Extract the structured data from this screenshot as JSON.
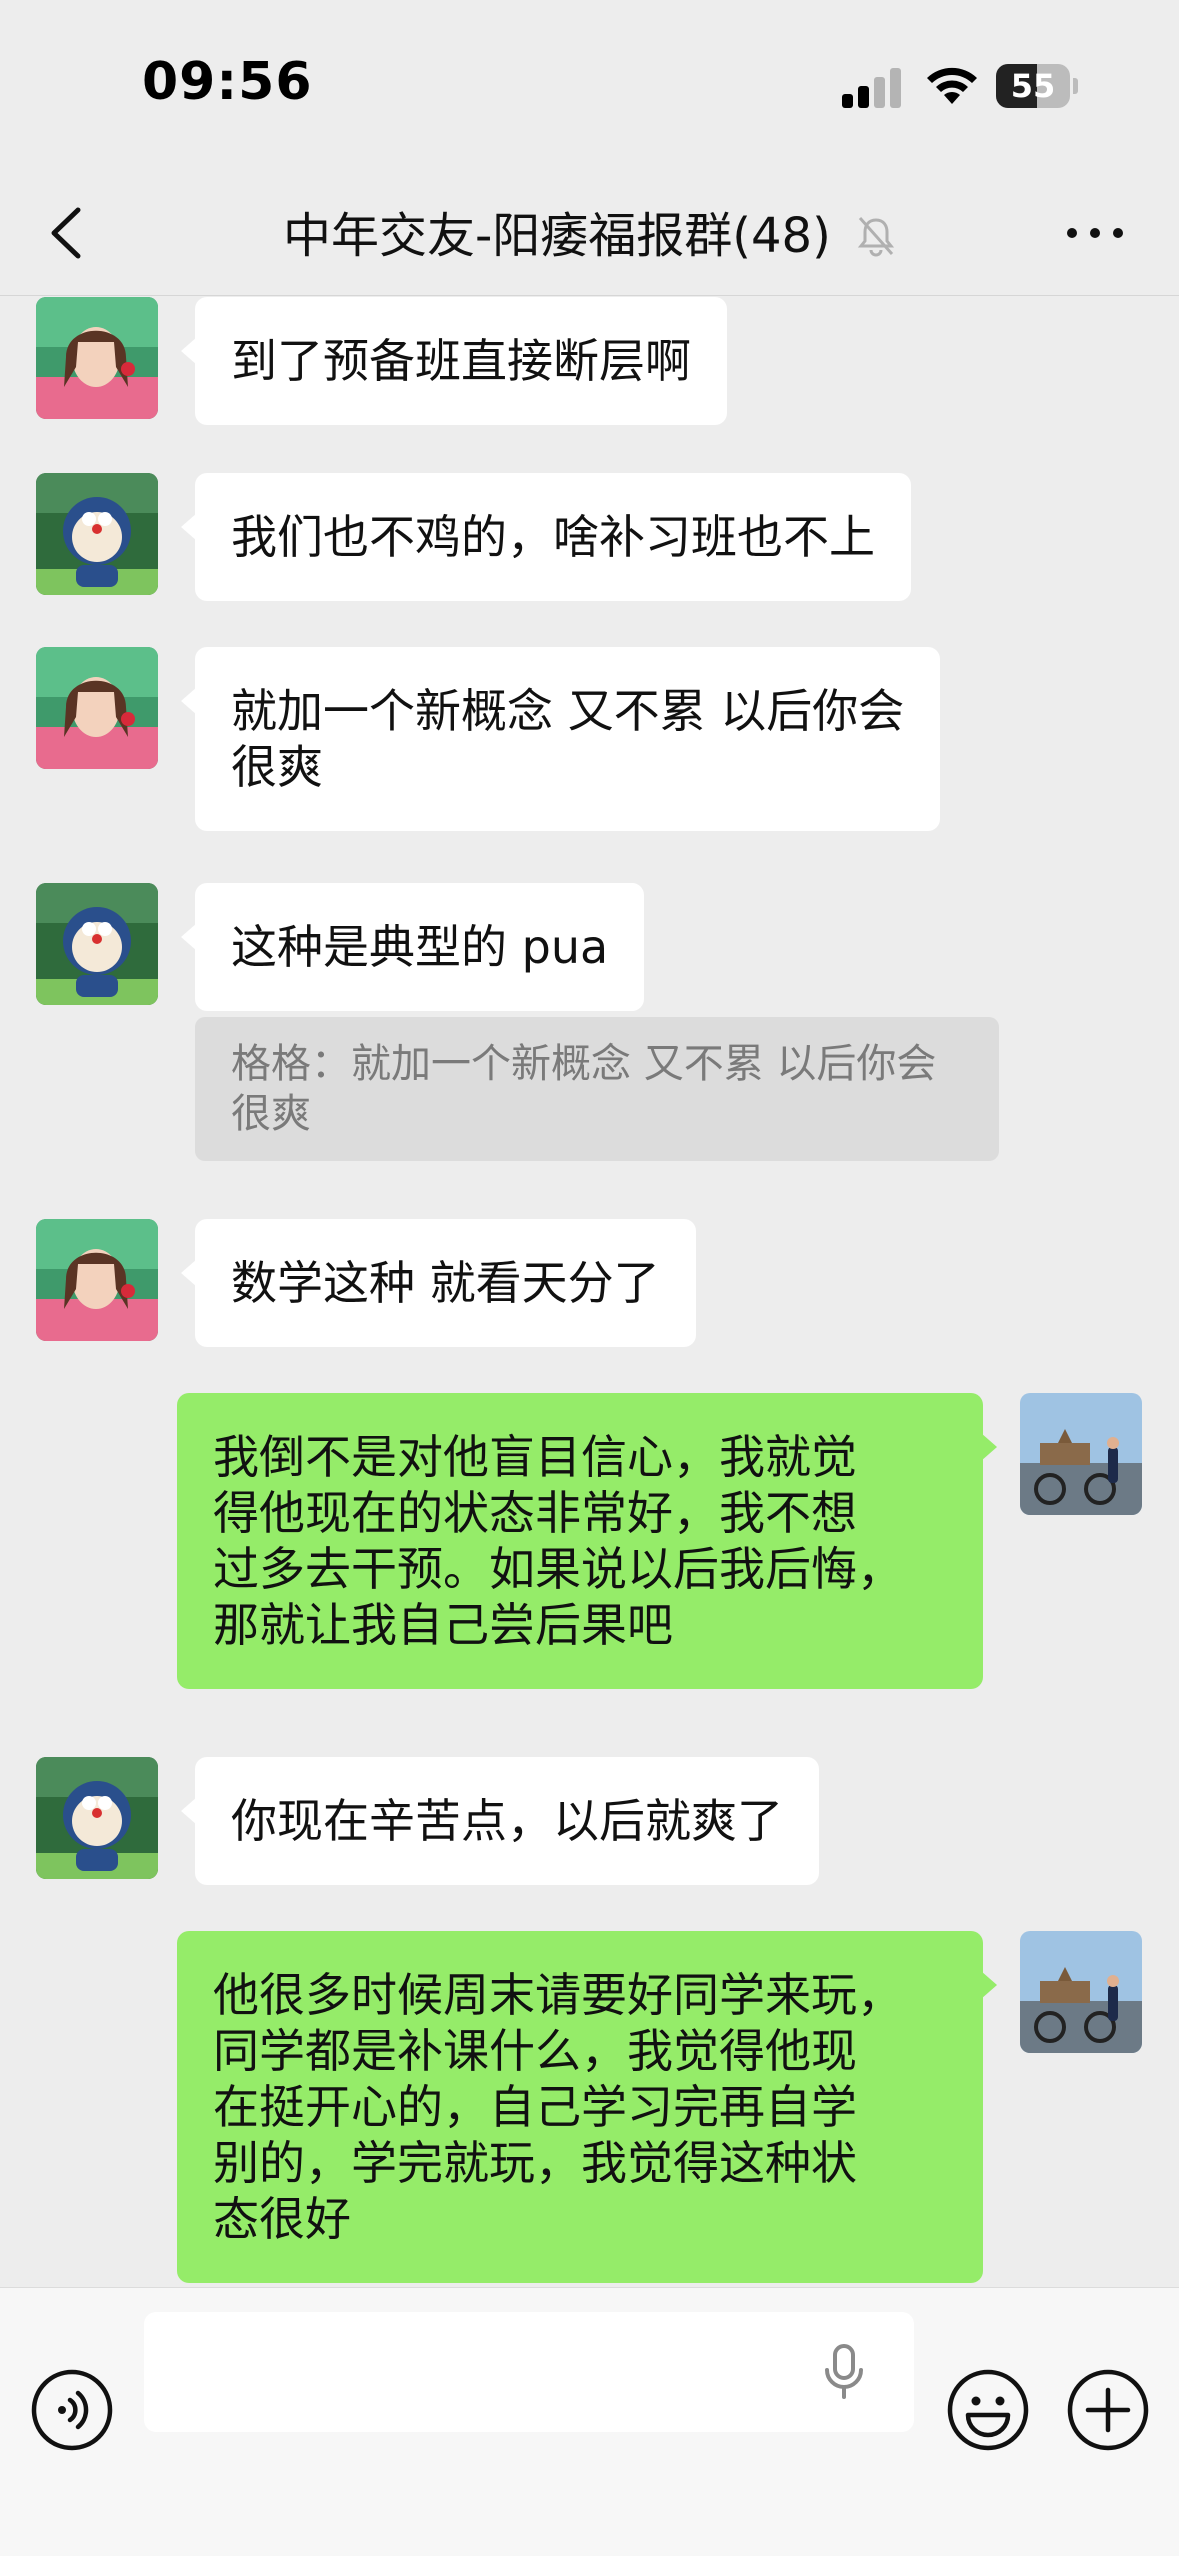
{
  "status_bar": {
    "time": "09:56",
    "battery_level": "55",
    "battery_percent": 55
  },
  "nav": {
    "title": "中年交友-阳痿福报群(48)",
    "muted_icon": "bell-slash-icon",
    "back_icon": "chevron-left-icon",
    "more_icon": "ellipsis-icon"
  },
  "messages": [
    {
      "side": "left",
      "avatar": "woman-avatar",
      "text": "到了预备班直接断层啊"
    },
    {
      "side": "left",
      "avatar": "doraemon-avatar",
      "text": "我们也不鸡的，啥补习班也不上"
    },
    {
      "side": "left",
      "avatar": "woman-avatar",
      "text_lines": [
        "就加一个新概念 又不累 以后你会",
        "很爽"
      ]
    },
    {
      "side": "left",
      "avatar": "doraemon-avatar",
      "text": "这种是典型的 pua",
      "quote_lines": [
        "格格：就加一个新概念 又不累 以后你会",
        "很爽"
      ]
    },
    {
      "side": "left",
      "avatar": "woman-avatar",
      "text": "数学这种 就看天分了"
    },
    {
      "side": "right",
      "avatar": "cyclist-avatar",
      "text_lines": [
        "我倒不是对他盲目信心，我就觉",
        "得他现在的状态非常好，我不想",
        "过多去干预。如果说以后我后悔，",
        "那就让我自己尝后果吧"
      ]
    },
    {
      "side": "left",
      "avatar": "doraemon-avatar",
      "text": "你现在辛苦点，以后就爽了"
    },
    {
      "side": "right",
      "avatar": "cyclist-avatar",
      "text_lines": [
        "他很多时候周末请要好同学来玩，",
        "同学都是补课什么，我觉得他现",
        "在挺开心的，自己学习完再自学",
        "别的，学完就玩，我觉得这种状",
        "态很好"
      ]
    }
  ],
  "input_bar": {
    "voice_icon": "voice-icon",
    "mic_icon": "microphone-icon",
    "emoji_icon": "emoji-icon",
    "plus_icon": "plus-icon",
    "input_value": ""
  },
  "colors": {
    "background": "#ededed",
    "bubble_self": "#95ec69",
    "bubble_other": "#ffffff",
    "quote_bg": "#dcdcdc"
  }
}
